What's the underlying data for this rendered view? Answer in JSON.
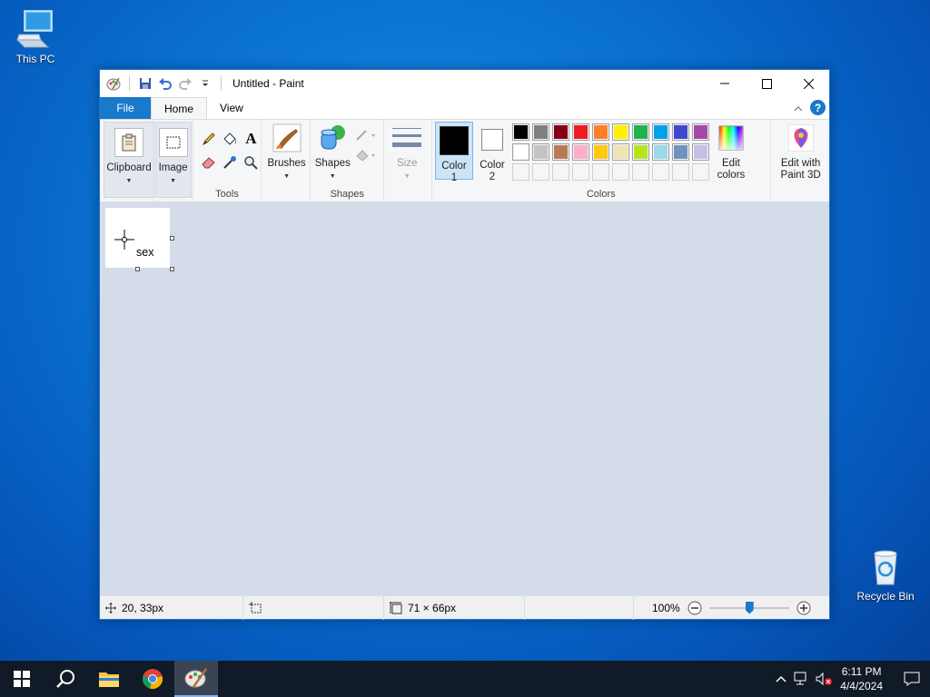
{
  "desktop": {
    "icons": [
      {
        "label": "This PC"
      },
      {
        "label": "Recycle Bin"
      }
    ]
  },
  "window": {
    "title": "Untitled - Paint",
    "tabs": {
      "file": "File",
      "home": "Home",
      "view": "View"
    },
    "help_symbol": "?"
  },
  "ribbon": {
    "clipboard": "Clipboard",
    "image": "Image",
    "tools_label": "Tools",
    "brushes": "Brushes",
    "shapes_btn": "Shapes",
    "shapes_label": "Shapes",
    "size": "Size",
    "color1_line1": "Color",
    "color1_line2": "1",
    "color2_line1": "Color",
    "color2_line2": "2",
    "colors_label": "Colors",
    "edit_colors_line1": "Edit",
    "edit_colors_line2": "colors",
    "paint3d_line1": "Edit with",
    "paint3d_line2": "Paint 3D",
    "text_tool_glyph": "A",
    "palette_row1": [
      "#000000",
      "#7f7f7f",
      "#880015",
      "#ed1c24",
      "#ff7f27",
      "#fff200",
      "#22b14c",
      "#00a2e8",
      "#3f48cc",
      "#a349a4"
    ],
    "palette_row2": [
      "#ffffff",
      "#c3c3c3",
      "#b97a57",
      "#ffaec9",
      "#ffc90e",
      "#efe4b0",
      "#b5e61d",
      "#99d9ea",
      "#7092be",
      "#c8bfe7"
    ],
    "color1_value": "#000000",
    "color2_value": "#ffffff"
  },
  "canvas": {
    "text": "sex"
  },
  "status": {
    "cursor_pos": "20, 33px",
    "image_size": "71 × 66px",
    "zoom": "100%",
    "zoom_slider_fraction": 0.5
  },
  "taskbar": {
    "time": "6:11 PM",
    "date": "4/4/2024"
  }
}
